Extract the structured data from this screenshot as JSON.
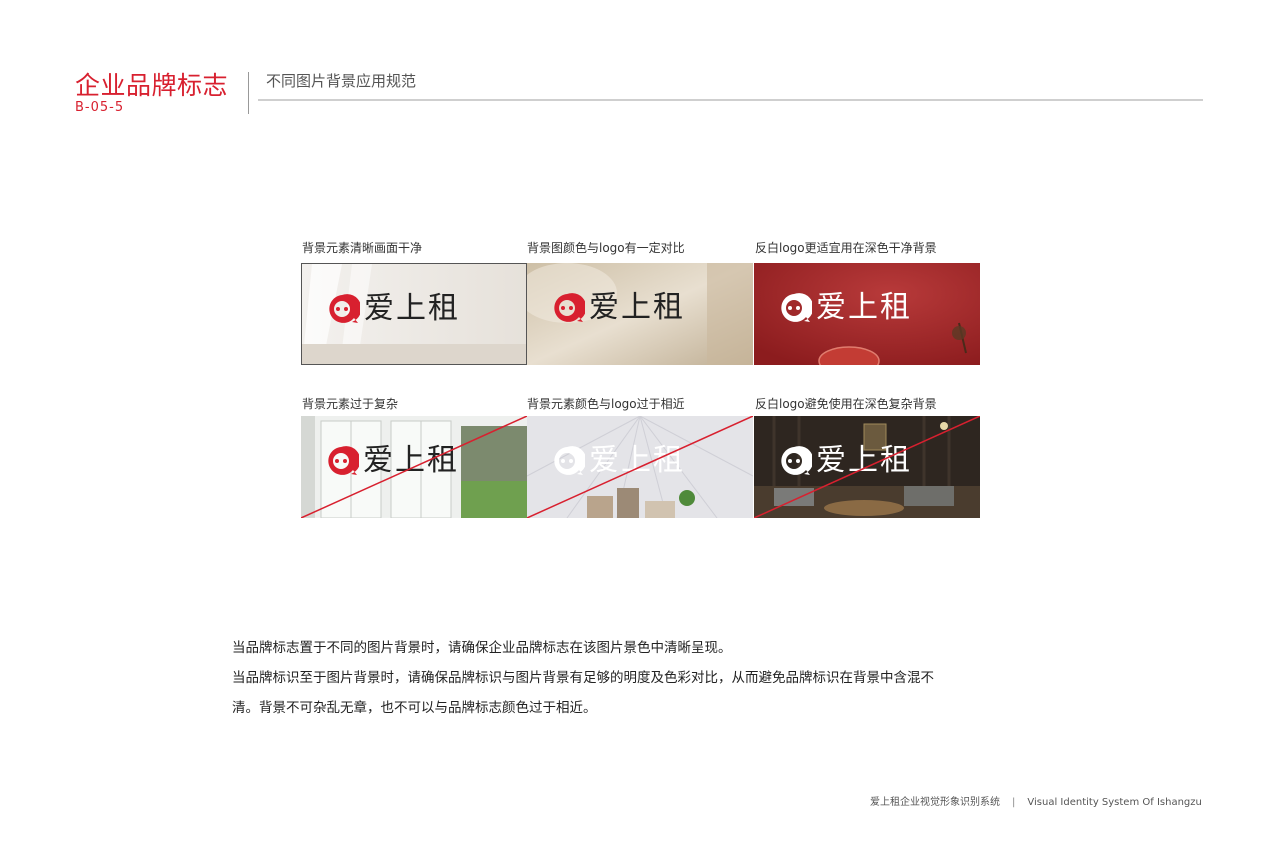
{
  "header": {
    "section_title": "企业品牌标志",
    "page_code": "B-05-5",
    "subtitle": "不同图片背景应用规范"
  },
  "logo": {
    "brand_name": "爱上租",
    "brand_red": "#d8202f",
    "icon": "speech-bubble-face-icon"
  },
  "examples": [
    {
      "caption": "背景元素清晰画面干净",
      "verdict": "correct",
      "logo_color": "#d8202f",
      "text_color": "#222222"
    },
    {
      "caption": "背景图颜色与logo有一定对比",
      "verdict": "correct",
      "logo_color": "#d8202f",
      "text_color": "#222222"
    },
    {
      "caption": "反白logo更适宜用在深色干净背景",
      "verdict": "correct",
      "logo_color": "#ffffff",
      "text_color": "#ffffff"
    },
    {
      "caption": "背景元素过于复杂",
      "verdict": "incorrect",
      "logo_color": "#d8202f",
      "text_color": "#222222"
    },
    {
      "caption": "背景元素颜色与logo过于相近",
      "verdict": "incorrect",
      "logo_color": "#ffffff",
      "text_color": "#ffffff"
    },
    {
      "caption": "反白logo避免使用在深色复杂背景",
      "verdict": "incorrect",
      "logo_color": "#ffffff",
      "text_color": "#ffffff"
    }
  ],
  "description": [
    "当品牌标志置于不同的图片背景时，请确保企业品牌标志在该图片景色中清晰呈现。",
    "当品牌标识至于图片背景时，请确保品牌标识与图片背景有足够的明度及色彩对比，从而避免品牌标识在背景中含混不",
    "清。背景不可杂乱无章，也不可以与品牌标志颜色过于相近。"
  ],
  "footer": {
    "system_cn": "爱上租企业视觉形象识别系统",
    "separator": "|",
    "system_en": "Visual Identity System Of Ishangzu"
  }
}
